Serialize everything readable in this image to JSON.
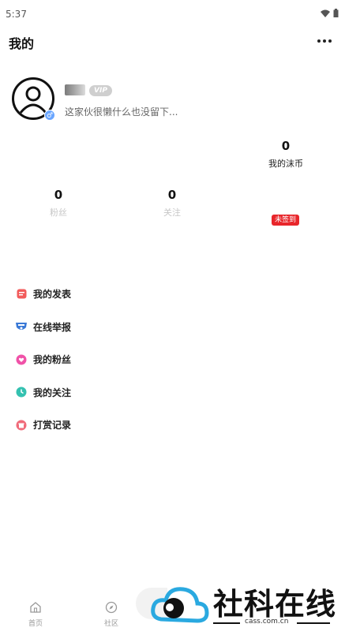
{
  "status_bar": {
    "time": "5:37",
    "icons": [
      "wifi-icon",
      "battery-icon"
    ]
  },
  "header": {
    "title": "我的",
    "more_icon": "more-dots-icon"
  },
  "profile": {
    "vip_label": "VIP",
    "bio": "这家伙很懒什么也没留下...",
    "gender_symbol": "♂"
  },
  "stats": {
    "coins": {
      "value": "0",
      "label": "我的沫币"
    },
    "fans": {
      "value": "0",
      "label": "粉丝"
    },
    "following": {
      "value": "0",
      "label": "关注"
    }
  },
  "signin_badge": "未签到",
  "menu": [
    {
      "label": "我的发表",
      "icon": "post-icon"
    },
    {
      "label": "在线举报",
      "icon": "report-icon"
    },
    {
      "label": "我的粉丝",
      "icon": "heart-icon"
    },
    {
      "label": "我的关注",
      "icon": "clock-icon"
    },
    {
      "label": "打赏记录",
      "icon": "gift-icon"
    }
  ],
  "bottom_nav": [
    {
      "label": "首页",
      "icon": "home-icon"
    },
    {
      "label": "社区",
      "icon": "compass-icon"
    }
  ],
  "watermark": {
    "text": "社科在线",
    "url": "cass.com.cn"
  },
  "colors": {
    "badge_red": "#e8262b",
    "gender_blue": "#6aa6ff",
    "watermark_blue": "#2aa9e0"
  }
}
